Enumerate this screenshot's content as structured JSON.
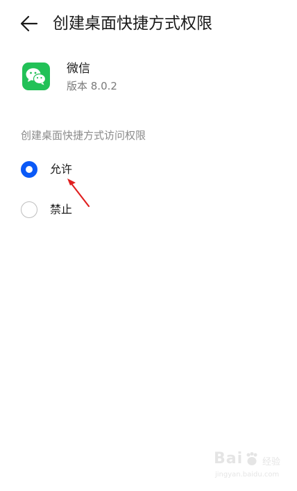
{
  "header": {
    "back_icon": "arrow-left-icon",
    "title": "创建桌面快捷方式权限"
  },
  "app": {
    "name": "微信",
    "version": "版本 8.0.2",
    "icon": "wechat-icon",
    "icon_color": "#22c157"
  },
  "permission": {
    "section_label": "创建桌面快捷方式访问权限",
    "options": [
      {
        "label": "允许",
        "checked": true
      },
      {
        "label": "禁止",
        "checked": false
      }
    ],
    "accent_color": "#0a59f7"
  },
  "annotation": {
    "icon": "red-arrow-icon",
    "color": "#e02020"
  },
  "watermark": {
    "brand": "Bai",
    "sub": "经验",
    "url": "jingyan.baidu.com"
  }
}
